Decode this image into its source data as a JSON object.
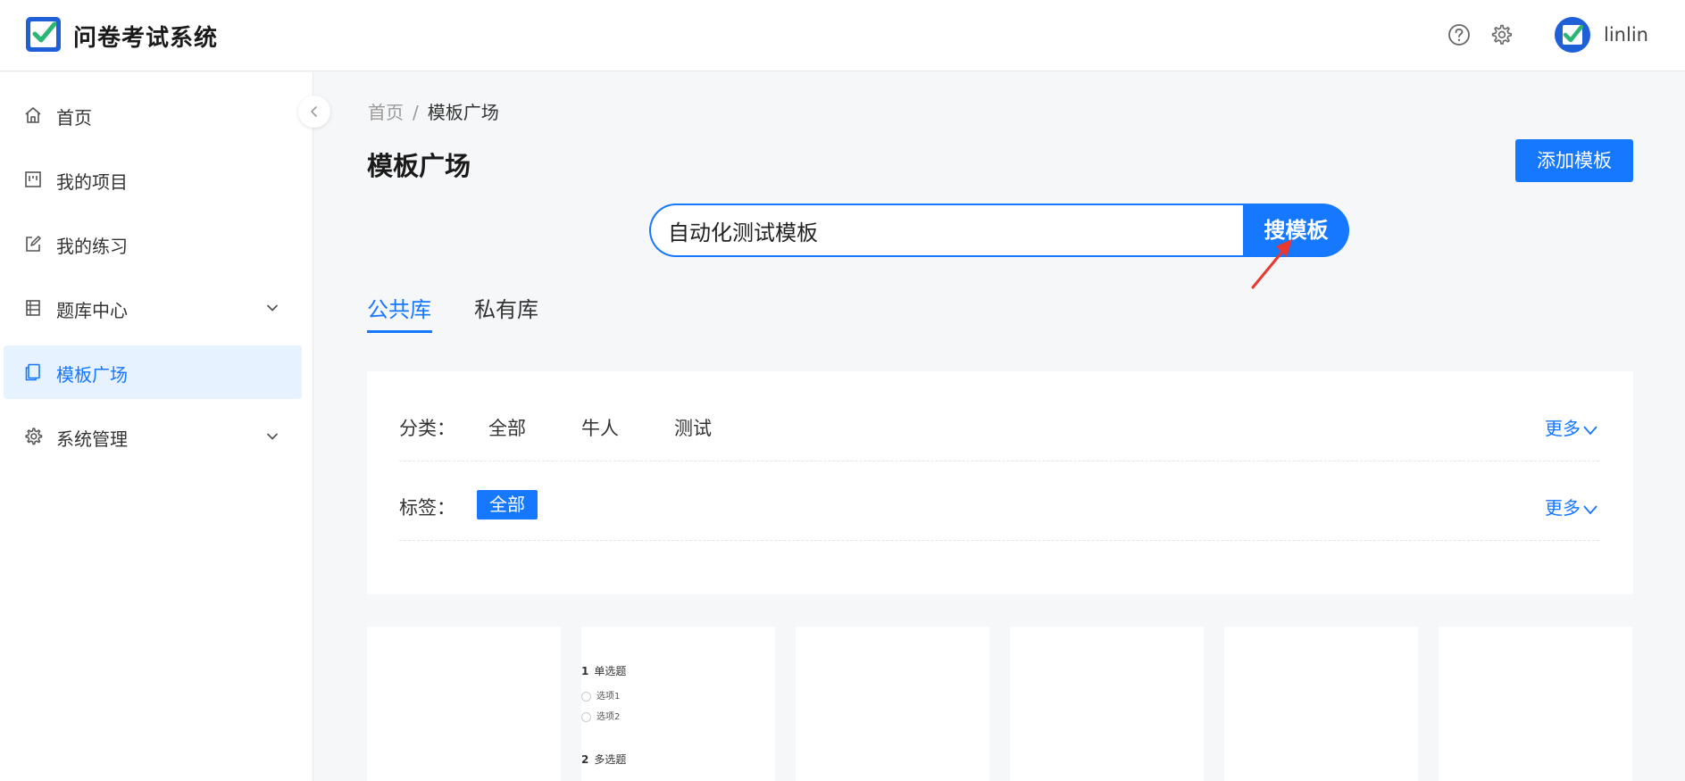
{
  "header": {
    "app_title": "问卷考试系统",
    "username": "linlin",
    "icons": [
      "help-icon",
      "gear-icon"
    ]
  },
  "sidebar": {
    "items": [
      {
        "label": "首页",
        "icon": "home-icon"
      },
      {
        "label": "我的项目",
        "icon": "project-icon"
      },
      {
        "label": "我的练习",
        "icon": "edit-icon"
      },
      {
        "label": "题库中心",
        "icon": "question-bank-icon",
        "has_submenu": true
      },
      {
        "label": "模板广场",
        "icon": "template-icon",
        "active": true
      },
      {
        "label": "系统管理",
        "icon": "gear-icon",
        "has_submenu": true
      }
    ]
  },
  "breadcrumb": {
    "home": "首页",
    "separator": "/",
    "current": "模板广场"
  },
  "page": {
    "title": "模板广场",
    "add_button": "添加模板"
  },
  "search": {
    "value": "自动化测试模板",
    "button": "搜模板"
  },
  "tabs": [
    {
      "label": "公共库",
      "active": true
    },
    {
      "label": "私有库",
      "active": false
    }
  ],
  "filters": {
    "category": {
      "label": "分类：",
      "options": [
        "全部",
        "牛人",
        "测试"
      ],
      "more": "更多"
    },
    "tags": {
      "label": "标签：",
      "options": [
        "全部"
      ],
      "selected": "全部",
      "more": "更多"
    }
  },
  "cards": [
    {},
    {
      "questions": [
        {
          "num": "1",
          "title": "单选题",
          "options": [
            "选项1",
            "选项2"
          ]
        },
        {
          "num": "2",
          "title": "多选题"
        }
      ]
    },
    {},
    {},
    {},
    {}
  ],
  "colors": {
    "accent": "#1677ff",
    "active_bg": "#e6f2ff",
    "page_bg": "#f6f7f9",
    "logo_check": "#2bb673"
  }
}
